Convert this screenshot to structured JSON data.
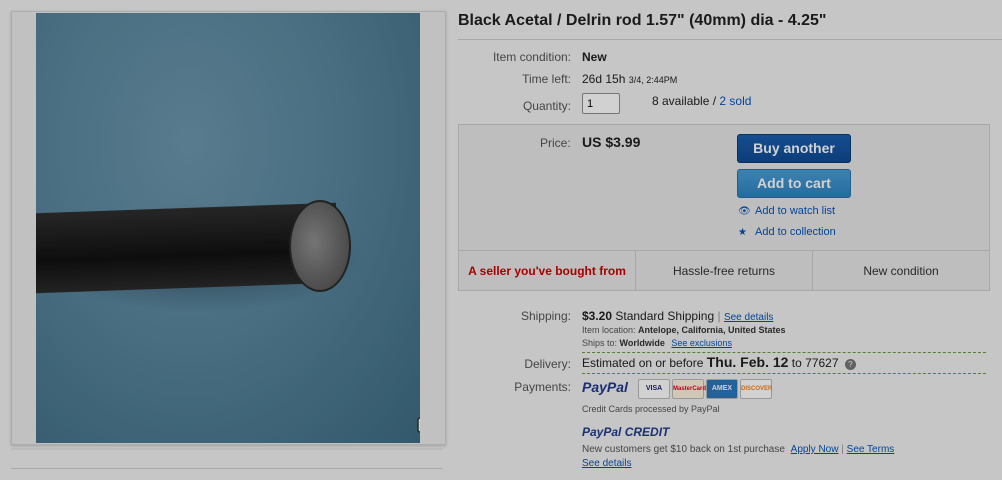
{
  "title": "Black Acetal / Delrin rod 1.57\" (40mm) dia - 4.25\"",
  "condition": {
    "label": "Item condition:",
    "value": "New"
  },
  "time_left": {
    "label": "Time left:",
    "value": "26d 15h",
    "detail": "3/4, 2:44PM"
  },
  "quantity": {
    "label": "Quantity:",
    "value": "1",
    "available": "8 available",
    "separator": "/",
    "sold": "2 sold"
  },
  "price": {
    "label": "Price:",
    "value": "US $3.99"
  },
  "buttons": {
    "buy_another": "Buy another",
    "add_to_cart": "Add to cart"
  },
  "links": {
    "watch": "Add to watch list",
    "collection": "Add to collection"
  },
  "features": [
    "A seller you've bought from",
    "Hassle-free returns",
    "New condition"
  ],
  "shipping": {
    "label": "Shipping:",
    "cost": "$3.20",
    "method": "Standard Shipping",
    "details_link": "See details",
    "location_label": "Item location:",
    "location": "Antelope, California, United States",
    "ships_label": "Ships to:",
    "ships_to": "Worldwide",
    "exclusions_link": "See exclusions"
  },
  "delivery": {
    "label": "Delivery:",
    "prefix": "Estimated on or before",
    "date": "Thu. Feb. 12",
    "to": "to 77627",
    "help_icon": "?"
  },
  "payments": {
    "label": "Payments:",
    "paypal": "PayPal",
    "cards": [
      "VISA",
      "MasterCard",
      "AMEX",
      "DISCOVER"
    ],
    "note": "Credit Cards processed by PayPal",
    "credit_logo": "PayPal CREDIT",
    "credit_text": "New customers get $10 back on 1st purchase",
    "apply_link": "Apply Now",
    "terms_link": "See Terms",
    "details_link": "See details"
  },
  "colors": {
    "accent": "#0654ba",
    "buy_button": "#1b5fb0",
    "cart_button": "#4aa0d8",
    "seller_badge": "#cc0000"
  }
}
